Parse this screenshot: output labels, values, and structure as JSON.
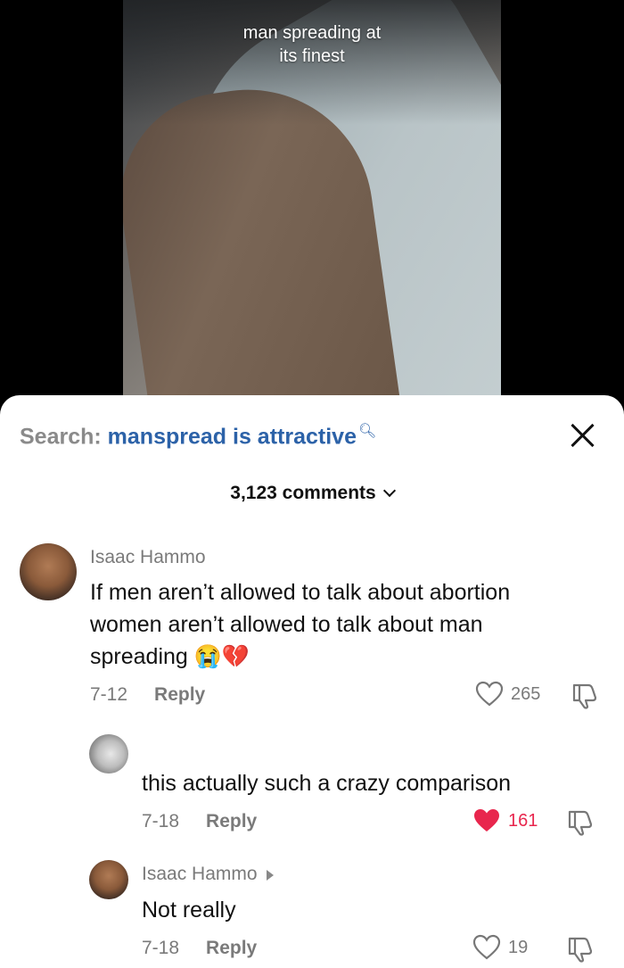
{
  "video": {
    "caption_line1": "man spreading at",
    "caption_line2": "its finest"
  },
  "search": {
    "label": "Search:",
    "query": "manspread is attractive"
  },
  "comments_header": {
    "count_label": "3,123 comments"
  },
  "comments": [
    {
      "author": "Isaac Hammo",
      "text_line1": "If men aren’t allowed to talk about abortion",
      "text_line2": "women aren’t allowed to talk about man",
      "text_line3": "spreading 😭💔",
      "date": "7-12",
      "reply": "Reply",
      "likes": "265"
    },
    {
      "author": "",
      "text": "this actually such a crazy comparison",
      "date": "7-18",
      "reply": "Reply",
      "likes": "161",
      "liked": true
    },
    {
      "author": "Isaac Hammo",
      "text": "Not really",
      "date": "7-18",
      "reply": "Reply",
      "likes": "19"
    }
  ],
  "colors": {
    "accent_blue": "#2c62a8",
    "like_red": "#e8264d",
    "muted": "#7a7a7a"
  },
  "icons": [
    "search-icon",
    "close-icon",
    "chevron-down-icon",
    "heart-icon",
    "dislike-icon",
    "reply-arrow-icon"
  ]
}
